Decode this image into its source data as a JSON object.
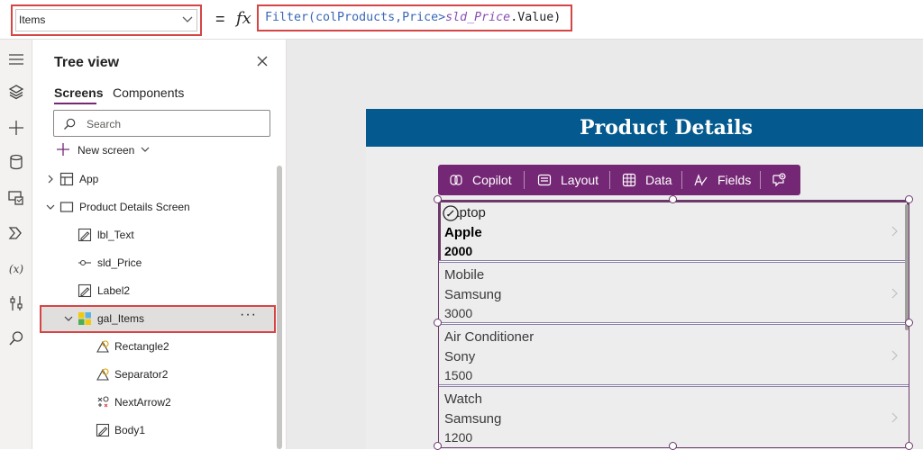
{
  "formula_bar": {
    "property": "Items",
    "equals": "=",
    "fx": "fx",
    "formula_fn": "Filter(colProducts,Price>",
    "formula_ctrl": "sld_Price",
    "formula_tail": ".Value)"
  },
  "tree": {
    "title": "Tree view",
    "tabs": [
      "Screens",
      "Components"
    ],
    "search_placeholder": "Search",
    "new_screen": "New screen",
    "nodes": {
      "app": "App",
      "screen": "Product Details Screen",
      "lbl_text": "lbl_Text",
      "sld_price": "sld_Price",
      "label2": "Label2",
      "gal_items": "gal_Items",
      "rectangle2": "Rectangle2",
      "separator2": "Separator2",
      "nextarrow2": "NextArrow2",
      "body1": "Body1"
    },
    "more": "···"
  },
  "canvas": {
    "header": "Product Details",
    "toolbar": {
      "copilot": "Copilot",
      "layout": "Layout",
      "data": "Data",
      "fields": "Fields"
    },
    "items": [
      {
        "title": "Laptop",
        "brand": "Apple",
        "price": "2000"
      },
      {
        "title": "Mobile",
        "brand": "Samsung",
        "price": "3000"
      },
      {
        "title": "Air Conditioner",
        "brand": "Sony",
        "price": "1500"
      },
      {
        "title": "Watch",
        "brand": "Samsung",
        "price": "1200"
      }
    ]
  },
  "colors": {
    "accent": "#742774",
    "header_band": "#045a8e",
    "highlight": "#d64545"
  }
}
